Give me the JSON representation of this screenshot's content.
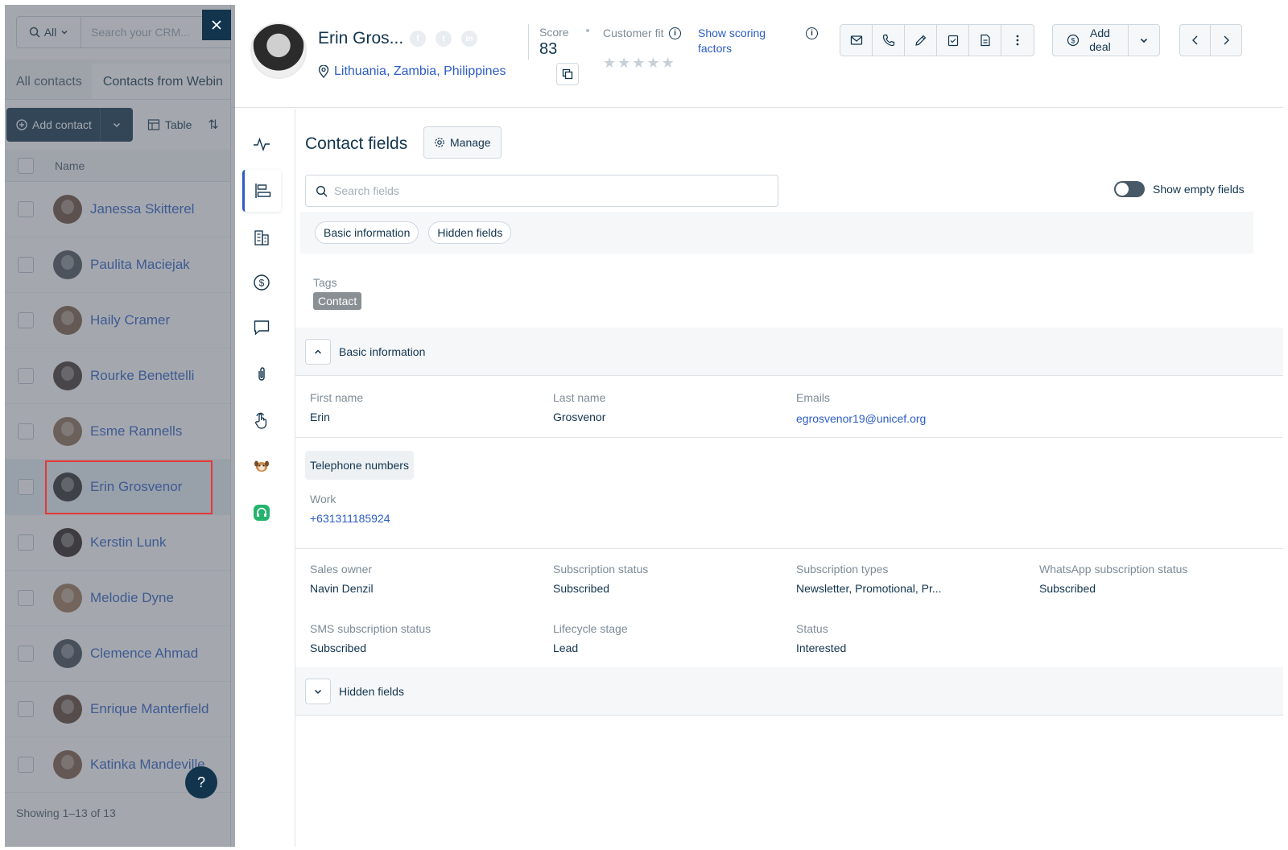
{
  "list": {
    "search_scope": "All",
    "search_placeholder": "Search your CRM...",
    "tabs": [
      "All contacts",
      "Contacts from Webin"
    ],
    "add_contact_label": "Add contact",
    "view_label": "Table",
    "name_header": "Name",
    "rows": [
      {
        "name": "Janessa Skitterel",
        "color": "#6b4a3a"
      },
      {
        "name": "Paulita Maciejak",
        "color": "#4a4f57"
      },
      {
        "name": "Haily Cramer",
        "color": "#7a5a44"
      },
      {
        "name": "Rourke Benettelli",
        "color": "#3f342c"
      },
      {
        "name": "Esme Rannells",
        "color": "#8a6a50"
      },
      {
        "name": "Erin Grosvenor",
        "color": "#2b2b2b"
      },
      {
        "name": "Kerstin Lunk",
        "color": "#2a1f1a"
      },
      {
        "name": "Melodie Dyne",
        "color": "#9a7355"
      },
      {
        "name": "Clemence Ahmad",
        "color": "#3c4650"
      },
      {
        "name": "Enrique Manterfield",
        "color": "#5a3f30"
      },
      {
        "name": "Katinka Mandeville",
        "color": "#7b5944"
      }
    ],
    "showing": "Showing 1–13 of 13",
    "help": "?"
  },
  "contact": {
    "name": "Erin Gros...",
    "location": "Lithuania, Zambia, Philippines",
    "score_label": "Score",
    "score": "83",
    "fit_label": "Customer fit",
    "stars": "★★★★★",
    "scoring_link": "Show scoring factors",
    "add_deal_label": "Add deal"
  },
  "fields": {
    "title": "Contact fields",
    "manage_label": "Manage",
    "search_placeholder": "Search fields",
    "show_empty_label": "Show empty fields",
    "chips": [
      "Basic information",
      "Hidden fields"
    ],
    "tags_label": "Tags",
    "tag": "Contact",
    "basic_section": "Basic information",
    "hidden_section": "Hidden fields",
    "first_name_label": "First name",
    "first_name": "Erin",
    "last_name_label": "Last name",
    "last_name": "Grosvenor",
    "emails_label": "Emails",
    "email": "egrosvenor19@unicef.org",
    "telephone_group": "Telephone numbers",
    "work_label": "Work",
    "work_phone": "+631311185924",
    "sales_owner_label": "Sales owner",
    "sales_owner": "Navin Denzil",
    "sub_status_label": "Subscription status",
    "sub_status": "Subscribed",
    "sub_types_label": "Subscription types",
    "sub_types": "Newsletter, Promotional, Pr...",
    "wa_status_label": "WhatsApp subscription status",
    "wa_status": "Subscribed",
    "sms_status_label": "SMS subscription status",
    "sms_status": "Subscribed",
    "lifecycle_label": "Lifecycle stage",
    "lifecycle": "Lead",
    "status_label": "Status",
    "status": "Interested"
  },
  "colors": {
    "brand_dark": "#12344d",
    "link": "#2c5cc5",
    "selection": "#e53935"
  }
}
